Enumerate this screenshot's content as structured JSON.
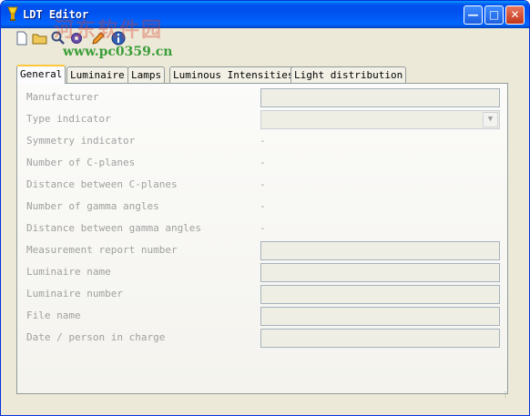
{
  "window": {
    "title": "LDT Editor",
    "minimize_glyph": "—",
    "maximize_glyph": "□",
    "close_glyph": "✕"
  },
  "watermark": {
    "logo_text": "河东软件园",
    "url": "www.pc0359.cn"
  },
  "toolbar": {
    "icons": [
      "new-file-icon",
      "open-folder-icon",
      "search-icon",
      "settings-gear-icon",
      "edit-pencil-icon",
      "info-icon"
    ]
  },
  "tabs": [
    {
      "label": "General",
      "active": true
    },
    {
      "label": "Luminaire",
      "active": false
    },
    {
      "label": "Lamps",
      "active": false
    },
    {
      "label": "Luminous Intensities",
      "active": false
    },
    {
      "label": "Light distribution",
      "active": false
    }
  ],
  "general": {
    "manufacturer": {
      "label": "Manufacturer",
      "value": ""
    },
    "type_indicator": {
      "label": "Type indicator",
      "value": ""
    },
    "symmetry_indicator": {
      "label": "Symmetry indicator",
      "value": "-"
    },
    "number_c_planes": {
      "label": "Number of C-planes",
      "value": "-"
    },
    "distance_c_planes": {
      "label": "Distance between C-planes",
      "value": "-"
    },
    "number_gamma": {
      "label": "Number of gamma angles",
      "value": "-"
    },
    "distance_gamma": {
      "label": "Distance between gamma angles",
      "value": "-"
    },
    "measurement_report": {
      "label": "Measurement report number",
      "value": ""
    },
    "luminaire_name": {
      "label": "Luminaire name",
      "value": ""
    },
    "luminaire_number": {
      "label": "Luminaire number",
      "value": ""
    },
    "file_name": {
      "label": "File name",
      "value": ""
    },
    "date_person": {
      "label": "Date / person in charge",
      "value": ""
    }
  },
  "colors": {
    "titlebar": "#0054e3",
    "window_bg": "#ece9d8",
    "disabled_text": "#a0a0a0",
    "active_tab_accent": "#ffc83c"
  }
}
